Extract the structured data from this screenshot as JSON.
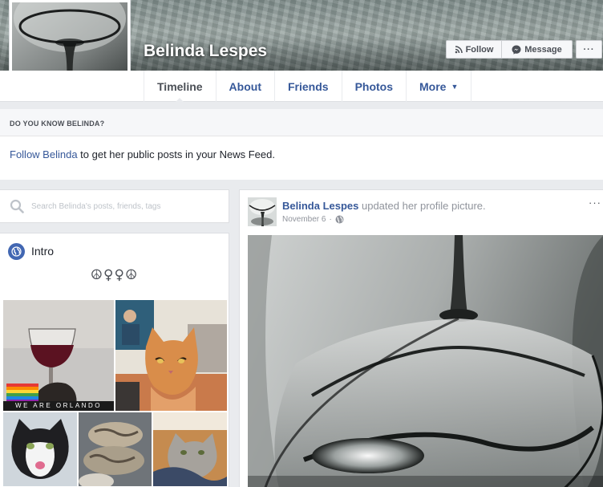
{
  "profile": {
    "name": "Belinda Lespes"
  },
  "cover_actions": {
    "follow_label": "Follow",
    "message_label": "Message",
    "more_label": "···"
  },
  "tabs": [
    {
      "label": "Timeline",
      "active": true
    },
    {
      "label": "About"
    },
    {
      "label": "Friends"
    },
    {
      "label": "Photos"
    },
    {
      "label": "More"
    }
  ],
  "know_box": {
    "heading": "DO YOU KNOW BELINDA?",
    "link": "Follow Belinda",
    "text": " to get her public posts in your News Feed."
  },
  "search": {
    "placeholder": "Search Belinda's posts, friends, tags"
  },
  "intro": {
    "title": "Intro",
    "symbols": "☮♀♀☮"
  },
  "photos": {
    "caption": "WE ARE ORLANDO"
  },
  "post": {
    "author": "Belinda Lespes",
    "action": " updated her profile picture.",
    "date": "November 6",
    "separator": "·",
    "menu_label": "···"
  },
  "colors": {
    "link": "#365899",
    "accent": "#4267b2",
    "background": "#e9ebee"
  },
  "icons": [
    "rss-icon",
    "messenger-icon",
    "more-icon",
    "search-icon",
    "globe-icon",
    "public-icon",
    "caret-down-icon"
  ]
}
